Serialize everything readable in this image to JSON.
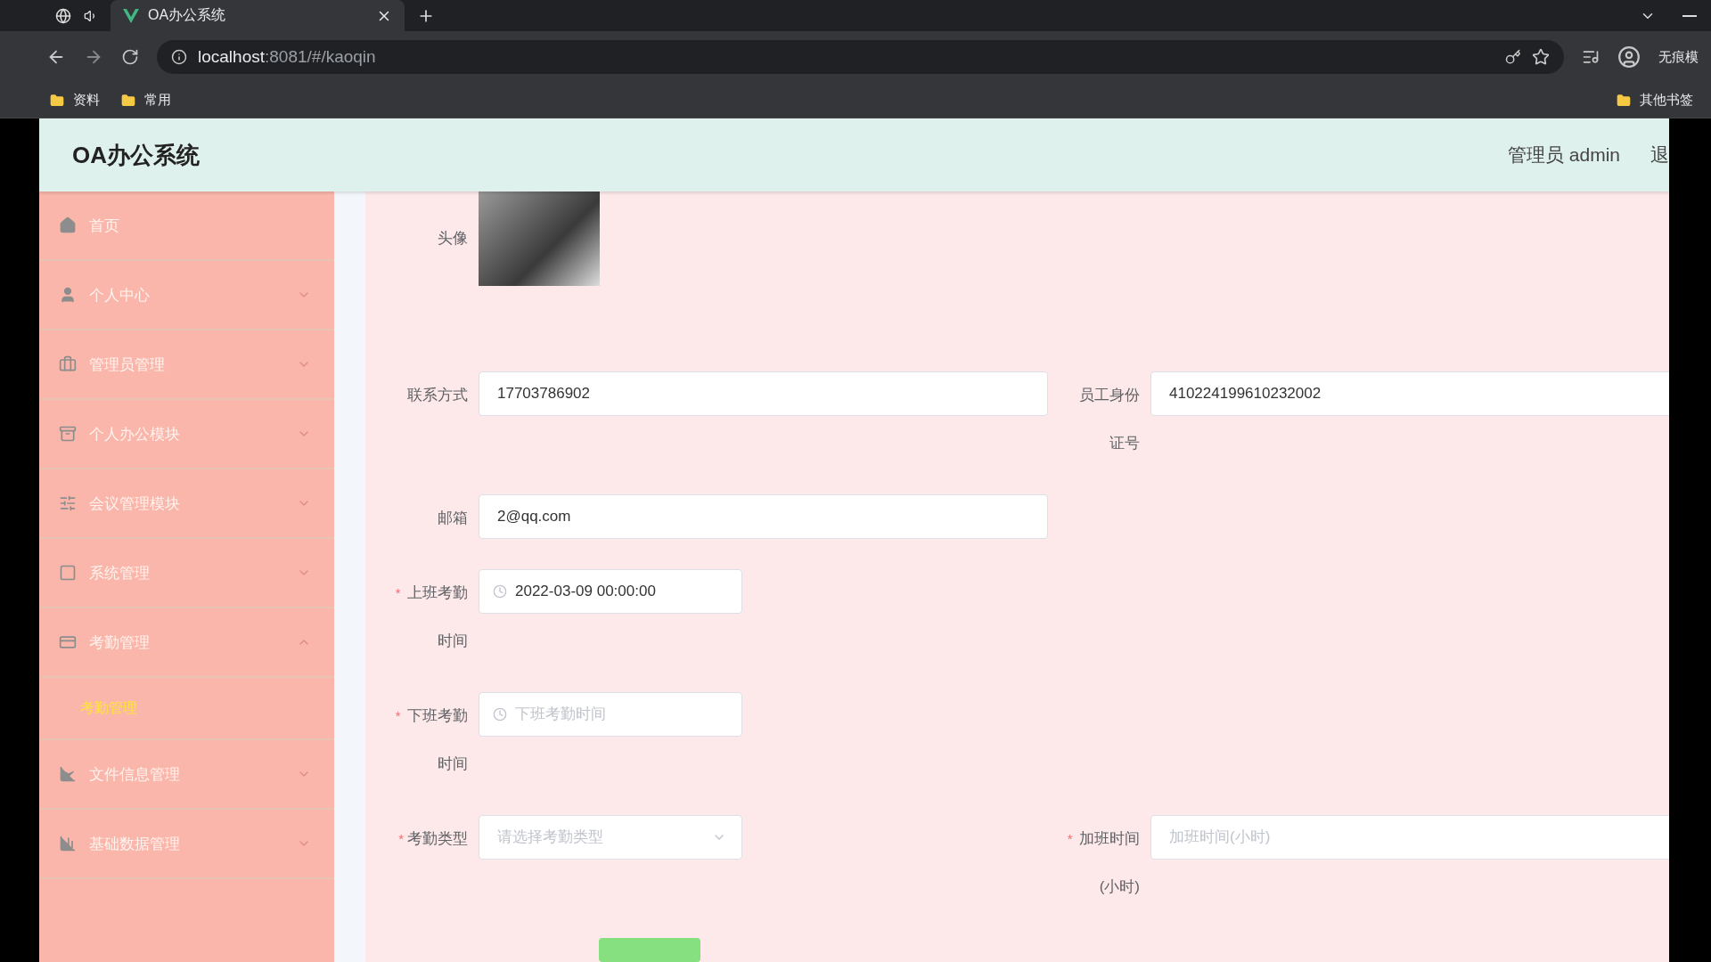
{
  "browser": {
    "tab_title": "OA办公系统",
    "url_host": "localhost",
    "url_path": ":8081/#/kaoqin",
    "profile_label": "无痕模",
    "bookmarks": [
      "资料",
      "常用"
    ],
    "other_bookmarks": "其他书签"
  },
  "header": {
    "title": "OA办公系统",
    "user": "管理员 admin",
    "logout": "退"
  },
  "sidebar": {
    "items": [
      {
        "label": "首页",
        "expandable": false
      },
      {
        "label": "个人中心",
        "expandable": true,
        "expanded": false
      },
      {
        "label": "管理员管理",
        "expandable": true,
        "expanded": false
      },
      {
        "label": "个人办公模块",
        "expandable": true,
        "expanded": false
      },
      {
        "label": "会议管理模块",
        "expandable": true,
        "expanded": false
      },
      {
        "label": "系统管理",
        "expandable": true,
        "expanded": false
      },
      {
        "label": "考勤管理",
        "expandable": true,
        "expanded": true,
        "children": [
          {
            "label": "考勤管理",
            "selected": true
          }
        ]
      },
      {
        "label": "文件信息管理",
        "expandable": true,
        "expanded": false
      },
      {
        "label": "基础数据管理",
        "expandable": true,
        "expanded": false
      }
    ]
  },
  "form": {
    "rows": [
      [
        {
          "kind": "image",
          "label": "头像"
        }
      ],
      [
        {
          "kind": "text",
          "label": "联系方式",
          "value": "17703786902"
        },
        {
          "kind": "text",
          "label": "员工身份证号",
          "value": "410224199610232002"
        }
      ],
      [
        {
          "kind": "text",
          "label": "邮箱",
          "value": "2@qq.com"
        }
      ],
      [
        {
          "kind": "date",
          "label": "上班考勤时间",
          "required_mark": "*",
          "value": "2022-03-09 00:00:00"
        }
      ],
      [
        {
          "kind": "date",
          "label": "下班考勤时间",
          "required_mark": "*",
          "placeholder": "下班考勤时间"
        }
      ],
      [
        {
          "kind": "select",
          "label": "考勤类型",
          "required_mark": "*",
          "placeholder": "请选择考勤类型"
        },
        {
          "kind": "text",
          "label": "加班时间(小时)",
          "required_mark": "*",
          "placeholder": "加班时间(小时)"
        }
      ]
    ]
  }
}
